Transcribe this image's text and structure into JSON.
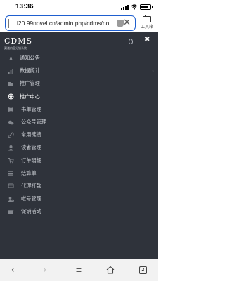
{
  "status_bar": {
    "time": "13:36"
  },
  "browser": {
    "url": "l20.99novel.cn/admin.php/cdms/no...",
    "toolbox_label": "工具箱",
    "tab_count": "2"
  },
  "app": {
    "logo": "CDMS",
    "subtitle": "渠道内容分销系统"
  },
  "menu": [
    {
      "label": "通知公告",
      "level": 1,
      "icon": "bell-icon"
    },
    {
      "label": "数据统计",
      "level": 1,
      "icon": "chart-icon",
      "has_arrow": true
    },
    {
      "label": "推广管理",
      "level": 1,
      "icon": "folder-icon"
    },
    {
      "label": "推广中心",
      "level": 1,
      "icon": "globe-icon",
      "active": true
    },
    {
      "label": "书单管理",
      "level": 2,
      "icon": "book-icon"
    },
    {
      "label": "公众号管理",
      "level": 2,
      "icon": "wechat-icon"
    },
    {
      "label": "常用链接",
      "level": 2,
      "icon": "link-icon"
    },
    {
      "label": "读者管理",
      "level": 2,
      "icon": "user-icon"
    },
    {
      "label": "订单明细",
      "level": 2,
      "icon": "cart-icon"
    },
    {
      "label": "结算单",
      "level": 2,
      "icon": "list-icon"
    },
    {
      "label": "代理打款",
      "level": 2,
      "icon": "card-icon"
    },
    {
      "label": "帐号管理",
      "level": 2,
      "icon": "user-gear-icon"
    },
    {
      "label": "促销活动",
      "level": 2,
      "icon": "gift-icon"
    }
  ],
  "colors": {
    "panel_bg": "#2f333b",
    "url_border": "#1f5fcf"
  }
}
